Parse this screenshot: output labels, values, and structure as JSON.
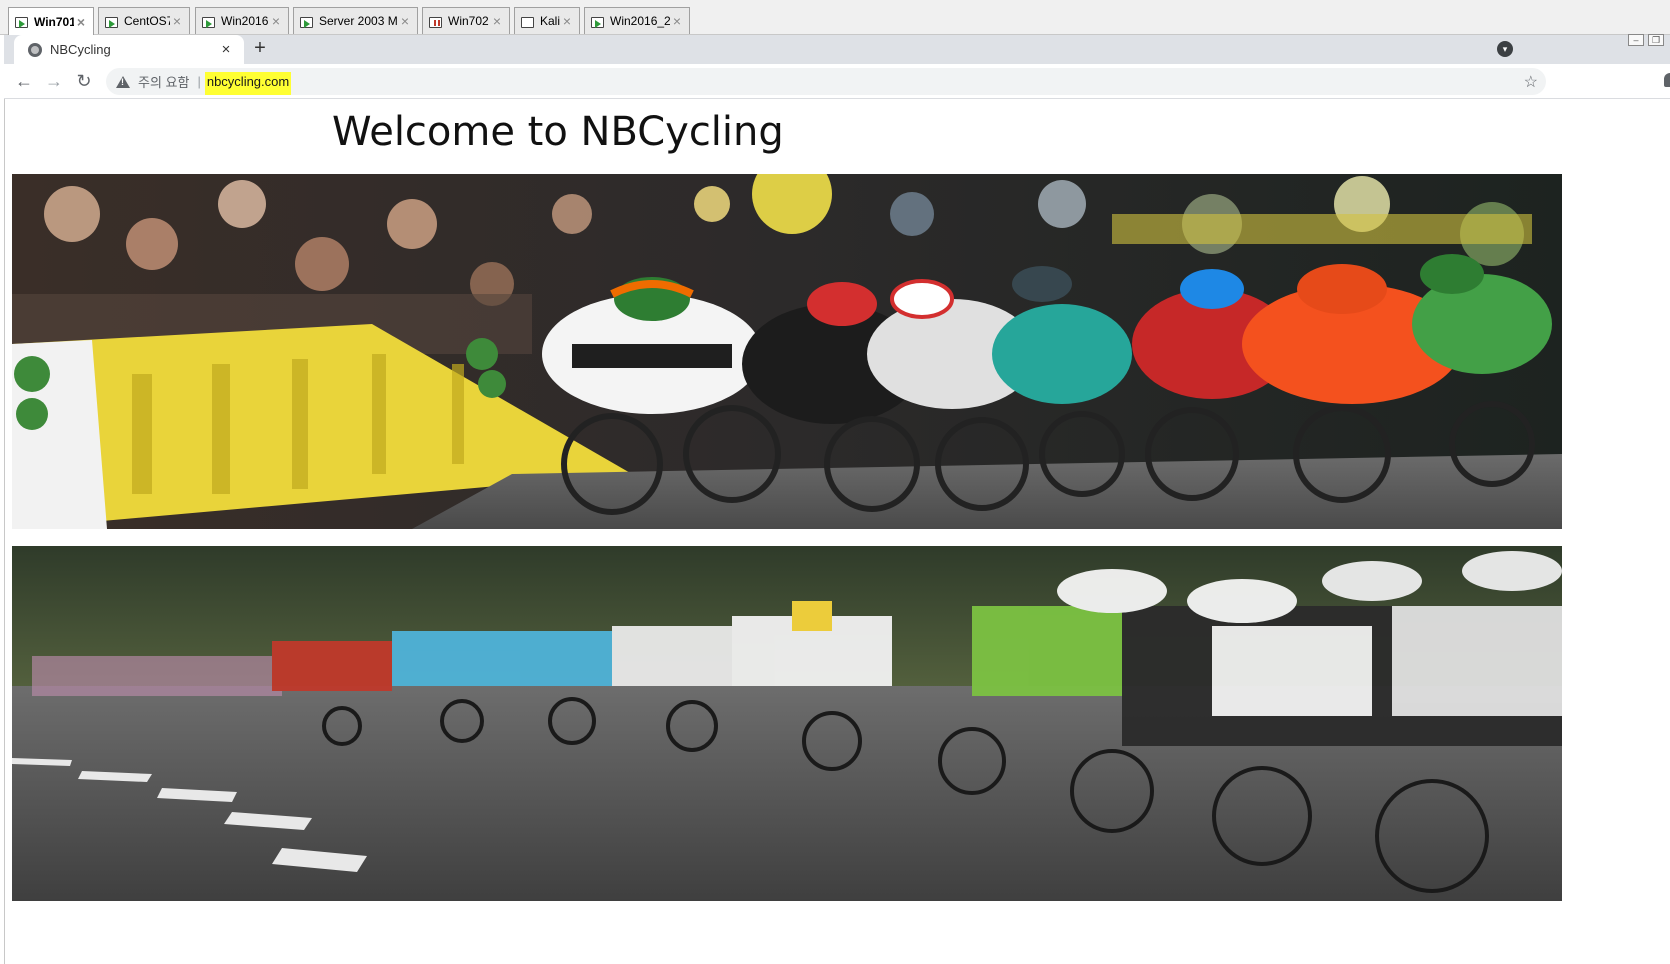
{
  "vm_tabs": [
    {
      "label": "Win701",
      "active": true,
      "icon": "vm-running-icon"
    },
    {
      "label": "CentOS7",
      "active": false,
      "icon": "vm-running-icon"
    },
    {
      "label": "Win2016",
      "active": false,
      "icon": "vm-running-icon"
    },
    {
      "label": "Server 2003 M",
      "active": false,
      "icon": "vm-running-icon"
    },
    {
      "label": "Win702",
      "active": false,
      "icon": "vm-paused-icon"
    },
    {
      "label": "Kali",
      "active": false,
      "icon": "vm-off-icon"
    },
    {
      "label": "Win2016_2",
      "active": false,
      "icon": "vm-running-icon"
    }
  ],
  "browser": {
    "tab_title": "NBCycling",
    "new_tab_symbol": "+",
    "security_label": "주의 요함",
    "separator": "|",
    "url": "nbcycling.com",
    "url_highlight_color": "#ffff33"
  },
  "nav": {
    "back_symbol": "←",
    "forward_symbol": "→",
    "reload_symbol": "↻",
    "star_symbol": "☆",
    "close_symbol": "×"
  },
  "page": {
    "heading": "Welcome to NBCycling",
    "images": [
      {
        "name": "sprint-finish-photo",
        "description_icon": "cycling-sprint-image"
      },
      {
        "name": "peloton-road-photo",
        "description_icon": "cycling-peloton-image"
      }
    ]
  }
}
